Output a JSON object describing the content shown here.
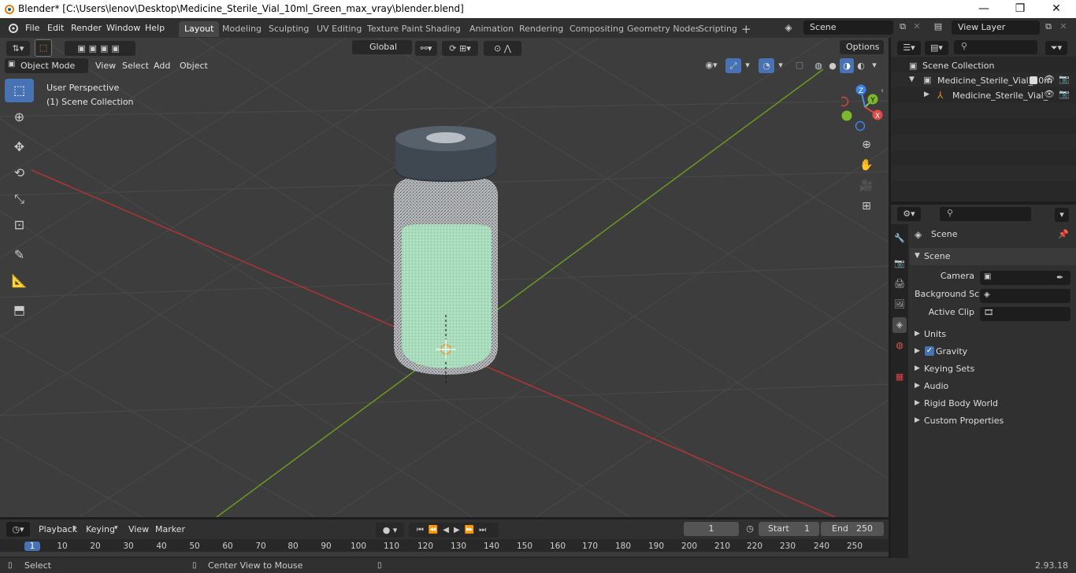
{
  "window": {
    "title": "Blender* [C:\\Users\\lenov\\Desktop\\Medicine_Sterile_Vial_10ml_Green_max_vray\\blender.blend]",
    "minimize": "—",
    "maximize": "❐",
    "close": "✕"
  },
  "menus": [
    "File",
    "Edit",
    "Render",
    "Window",
    "Help"
  ],
  "workspaces": [
    "Layout",
    "Modeling",
    "Sculpting",
    "UV Editing",
    "Texture Paint",
    "Shading",
    "Animation",
    "Rendering",
    "Compositing",
    "Geometry Nodes",
    "Scripting"
  ],
  "active_workspace": "Layout",
  "scene_selector": "Scene",
  "view_layer_selector": "View Layer",
  "toolbar": {
    "transform_orientation": "Global",
    "options": "Options"
  },
  "viewport": {
    "mode": "Object Mode",
    "menu": [
      "View",
      "Select",
      "Add",
      "Object"
    ],
    "overlay_line1": "User Perspective",
    "overlay_line2": "(1) Scene Collection",
    "axis_labels": {
      "x": "X",
      "y": "Y",
      "z": "Z"
    }
  },
  "outliner": {
    "root": "Scene Collection",
    "items": [
      {
        "label": "Medicine_Sterile_Vial_10m",
        "level": 1
      },
      {
        "label": "Medicine_Sterile_Vial_",
        "level": 2
      }
    ]
  },
  "properties": {
    "context": "Scene",
    "panel": "Scene",
    "fields": [
      {
        "label": "Camera",
        "value": ""
      },
      {
        "label": "Background Sc...",
        "value": ""
      },
      {
        "label": "Active Clip",
        "value": ""
      }
    ],
    "sections": [
      "Units",
      "Gravity",
      "Keying Sets",
      "Audio",
      "Rigid Body World",
      "Custom Properties"
    ],
    "gravity_checked": true
  },
  "timeline": {
    "menus": [
      "Playback",
      "Keying",
      "View",
      "Marker"
    ],
    "current_frame": "1",
    "start_label": "Start",
    "start": "1",
    "end_label": "End",
    "end": "250",
    "ticks": [
      "1",
      "10",
      "20",
      "30",
      "40",
      "50",
      "60",
      "70",
      "80",
      "90",
      "100",
      "110",
      "120",
      "130",
      "140",
      "150",
      "160",
      "170",
      "180",
      "190",
      "200",
      "210",
      "220",
      "230",
      "240",
      "250"
    ]
  },
  "status": {
    "left": "Select",
    "middle": "Center View to Mouse",
    "version": "2.93.18"
  },
  "colors": {
    "accent": "#4772b3",
    "axis_x": "#b03434",
    "axis_y": "#6b9a1f",
    "liquid": "#9ad8b0"
  }
}
